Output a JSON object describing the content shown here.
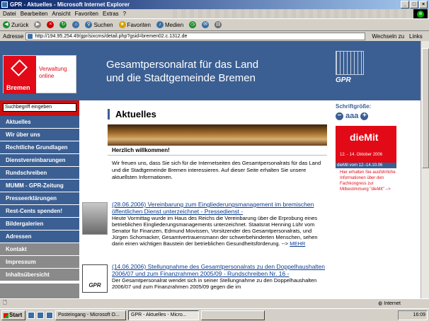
{
  "window": {
    "title": "GPR - Aktuelles - Microsoft Internet Explorer"
  },
  "menu": [
    "Datei",
    "Bearbeiten",
    "Ansicht",
    "Favoriten",
    "Extras",
    "?"
  ],
  "toolbar": {
    "back": "Zurück",
    "search": "Suchen",
    "favorites": "Favoriten",
    "media": "Medien"
  },
  "address": {
    "label": "Adresse",
    "url": "http://194.95.254.49/gpr/sixcms/detail.php?gsid=bremen02.c.1312.de",
    "go": "Wechseln zu",
    "links": "Links"
  },
  "site": {
    "logo_city": "Bremen",
    "logo_sub1": "Verwaltung",
    "logo_sub2": "online",
    "header_line1": "Gesamtpersonalrat für das Land",
    "header_line2": "und die Stadtgemeinde Bremen",
    "gpr_logo": "GPR",
    "search_placeholder": "Suchbegriff eingeben",
    "go_symbol": "↩"
  },
  "nav": [
    {
      "label": "Aktuelles",
      "section": "blue"
    },
    {
      "label": "Wir über uns",
      "section": "blue"
    },
    {
      "label": "Rechtliche Grundlagen",
      "section": "blue"
    },
    {
      "label": "Dienstvereinbarungen",
      "section": "blue"
    },
    {
      "label": "Rundschreiben",
      "section": "blue"
    },
    {
      "label": "MUMM - GPR-Zeitung",
      "section": "blue"
    },
    {
      "label": "Presseerklärungen",
      "section": "blue"
    },
    {
      "label": "Rest-Cents spenden!",
      "section": "blue"
    },
    {
      "label": "Bildergalerien",
      "section": "blue"
    },
    {
      "label": "Adressen",
      "section": "blue"
    },
    {
      "label": "Kontakt",
      "section": "gray"
    },
    {
      "label": "Impressum",
      "section": "gray"
    },
    {
      "label": "Inhaltsübersicht",
      "section": "gray"
    }
  ],
  "main": {
    "heading": "Aktuelles",
    "welcome": "Herzlich willkommen!",
    "intro": "Wir freuen uns, dass Sie sich für die Internetseiten des Gesamtpersonalrats für das Land und die Stadtgemeinde Bremen interessieren. Auf dieser Seite erhalten Sie unsere aktuellsten Informationen.",
    "articles": [
      {
        "title": "(28.06.2006) Vereinbarung zum Eingliederungsmanagement im bremischen öffentlichen Dienst unterzeichnet - Pressedienst -",
        "body": "Heute Vormittag wurde im Haus des Reichs die Vereinbarung über die Erprobung eines betrieblichen Eingliederungsmanagements unterzeichnet. Staatsrat Henning Lühr vom Senator für Finanzen, Edmund Movissen, Vorsitzender des Gesamtpersonalrats, und Jürgen Schomacker, Gesamtvertrauensmann der schwerbehinderten Menschen, sehen darin einen wichtigen Baustein der betrieblichen Gesundheitsförderung.",
        "more": "MEHR"
      },
      {
        "title": "(14.06.2006) Stellungnahme des Gesamtpersonalrats zu den Doppelhaushalten 2006/07 und zum Finanzrahmen 2005/09 - Rundschreiben Nr. 16 -",
        "body": "Der Gesamtpersonalrat wendet sich in seiner Stellungnahme zu den Doppelhaushalten 2006/07 und zum Finanzrahmen 2005/09 gegen die im"
      }
    ]
  },
  "sidebar_right": {
    "font_size_label": "Schriftgröße:",
    "font_size_letters": "aaa",
    "banner_title": "dieMit",
    "banner_dates": "12. - 14. Oktober 2006",
    "banner_bar": "dieMit vom 12.-14.10.06",
    "banner_text": "Hier erhalten Sie ausführliche Informationen über den Fachkongress zur Mitbestimmung \"dieMit\"",
    "banner_more": "-->"
  },
  "status": {
    "zone": "Internet"
  },
  "taskbar": {
    "start": "Start",
    "tasks": [
      "Posteingang - Microsoft O...",
      "GPR - Aktuelles - Micro...",
      ""
    ],
    "clock": "16:09"
  },
  "colors": {
    "brand_blue": "#3b5f93",
    "brand_red": "#e20a17",
    "nav_gray": "#8a8a8a"
  }
}
